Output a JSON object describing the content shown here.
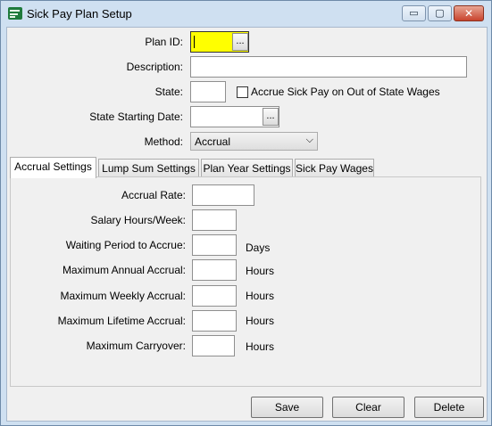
{
  "window": {
    "title": "Sick Pay Plan Setup",
    "controls": {
      "minimize": "▭",
      "maximize": "▢",
      "close": "✕"
    }
  },
  "form": {
    "plan_id_label": "Plan ID:",
    "plan_id_value": "",
    "plan_id_button": "...",
    "description_label": "Description:",
    "description_value": "",
    "state_label": "State:",
    "state_value": "",
    "accrue_checkbox_label": "Accrue Sick Pay on Out of State Wages",
    "accrue_checked": false,
    "start_date_label": "State Starting Date:",
    "start_date_value": "",
    "start_date_button": "...",
    "method_label": "Method:",
    "method_value": "Accrual",
    "plan_id_highlight_color": "#ffff00"
  },
  "tabs": [
    {
      "label": "Accrual Settings",
      "active": true
    },
    {
      "label": "Lump Sum Settings",
      "active": false
    },
    {
      "label": "Plan Year Settings",
      "active": false
    },
    {
      "label": "Sick Pay Wages",
      "active": false
    }
  ],
  "accrual": {
    "rate_label": "Accrual Rate:",
    "salary_hours_label": "Salary Hours/Week:",
    "waiting_label": "Waiting Period to Accrue:",
    "waiting_unit": "Days",
    "max_annual_label": "Maximum Annual Accrual:",
    "max_annual_unit": "Hours",
    "max_weekly_label": "Maximum Weekly Accrual:",
    "max_weekly_unit": "Hours",
    "max_lifetime_label": "Maximum Lifetime Accrual:",
    "max_lifetime_unit": "Hours",
    "max_carryover_label": "Maximum Carryover:",
    "max_carryover_unit": "Hours"
  },
  "buttons": {
    "save": "Save",
    "clear": "Clear",
    "delete": "Delete"
  }
}
